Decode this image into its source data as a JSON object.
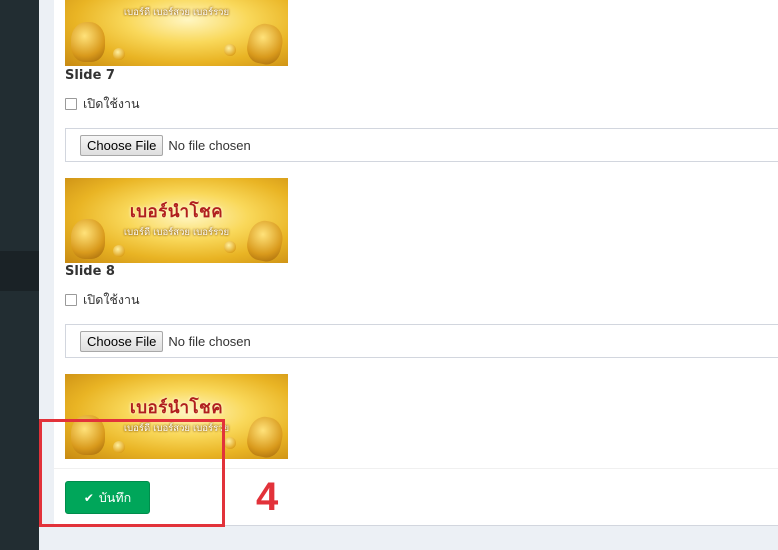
{
  "slides": [
    {
      "label": "Slide 7",
      "enable_label": "เปิดใช้งาน",
      "choose_file_label": "Choose File",
      "file_status": "No file chosen"
    },
    {
      "label": "Slide 8",
      "enable_label": "เปิดใช้งาน",
      "choose_file_label": "Choose File",
      "file_status": "No file chosen"
    }
  ],
  "banner": {
    "title": "เบอร์นำโชค",
    "subtitle": "เบอร์ดี เบอร์สวย เบอร์รวย"
  },
  "save_button": {
    "label": "บันทึก",
    "icon": "check-icon"
  },
  "annotation": {
    "step_number": "4",
    "color": "#e2323a"
  },
  "colors": {
    "sidebar": "#222d32",
    "save_button": "#00a65a",
    "content_bg": "#ecf0f5"
  }
}
